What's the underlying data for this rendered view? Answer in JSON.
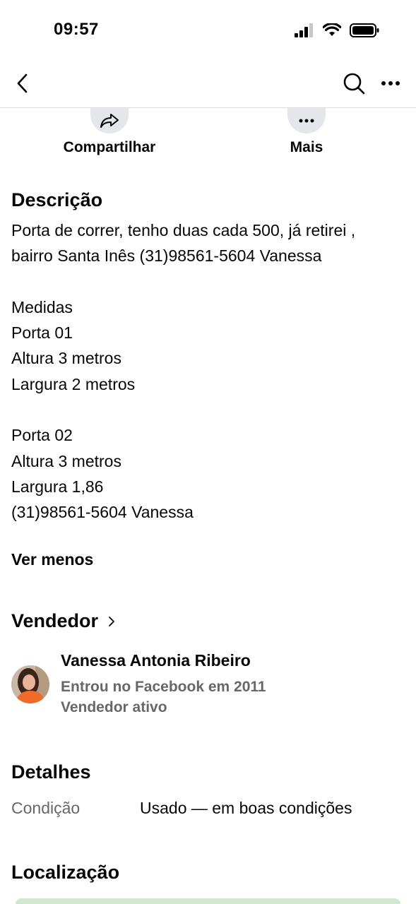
{
  "status_bar": {
    "time": "09:57",
    "icons": [
      "signal-icon",
      "wifi-icon",
      "battery-icon"
    ]
  },
  "nav": {
    "icons": [
      "back-chevron-icon",
      "search-icon",
      "more-horizontal-icon"
    ]
  },
  "actions": [
    {
      "label": "Compartilhar",
      "icon": "share-icon"
    },
    {
      "label": "Mais",
      "icon": "more-icon"
    }
  ],
  "description": {
    "title": "Descrição",
    "text": "Porta de correr, tenho duas cada 500, já retirei , bairro Santa Inês (31)98561-5604 Vanessa\n\nMedidas\nPorta 01\nAltura 3 metros\nLargura 2 metros\n\nPorta 02\nAltura 3 metros\nLargura 1,86\n(31)98561-5604 Vanessa",
    "see_less": "Ver menos"
  },
  "seller": {
    "title": "Vendedor",
    "name": "Vanessa Antonia Ribeiro",
    "joined": "Entrou no Facebook em 2011",
    "status": "Vendedor ativo"
  },
  "details": {
    "title": "Detalhes",
    "condition_label": "Condição",
    "condition_value": "Usado — em boas condições"
  },
  "location": {
    "title": "Localização"
  },
  "colors": {
    "text": "#050505",
    "secondary_text": "#65676b",
    "action_bg": "#e4e6eb"
  }
}
